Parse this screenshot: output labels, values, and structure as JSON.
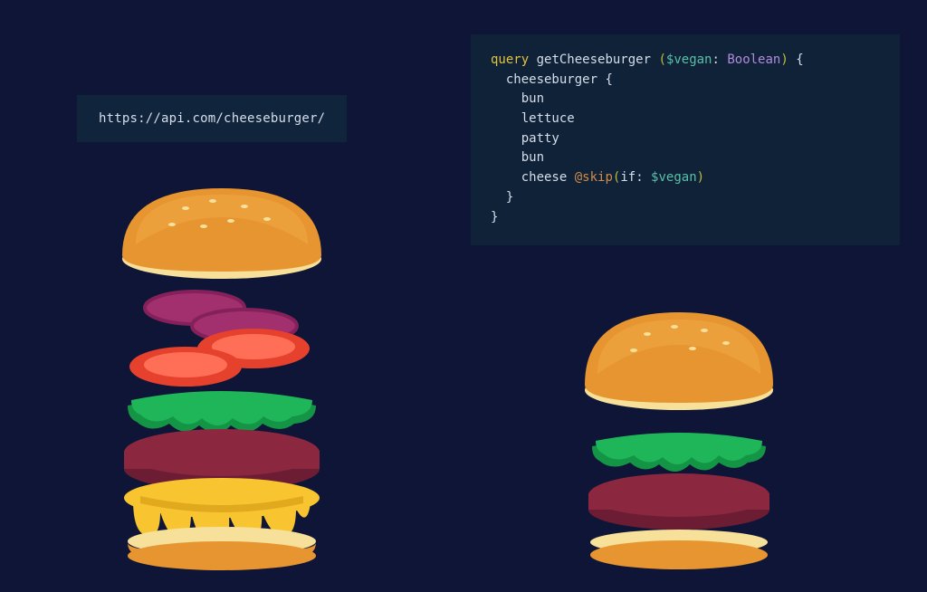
{
  "rest": {
    "url": "https://api.com/cheeseburger/"
  },
  "graphql": {
    "keyword": "query",
    "operation_name": "getCheeseburger",
    "variable": "$vegan",
    "variable_type": "Boolean",
    "root_field": "cheeseburger",
    "fields": [
      "bun",
      "lettuce",
      "patty",
      "bun",
      "cheese"
    ],
    "directive_name": "@skip",
    "directive_arg_key": "if",
    "directive_arg_value": "$vegan",
    "paren_open": "(",
    "paren_close": ")",
    "brace_open": "{",
    "brace_close": "}",
    "colon_space": ": "
  },
  "burger_left_layers": [
    "bun-top",
    "onion",
    "onion",
    "tomato",
    "tomato",
    "lettuce",
    "patty",
    "cheese",
    "bun-bottom"
  ],
  "burger_right_layers": [
    "bun-top",
    "lettuce",
    "patty",
    "bun-bottom"
  ]
}
